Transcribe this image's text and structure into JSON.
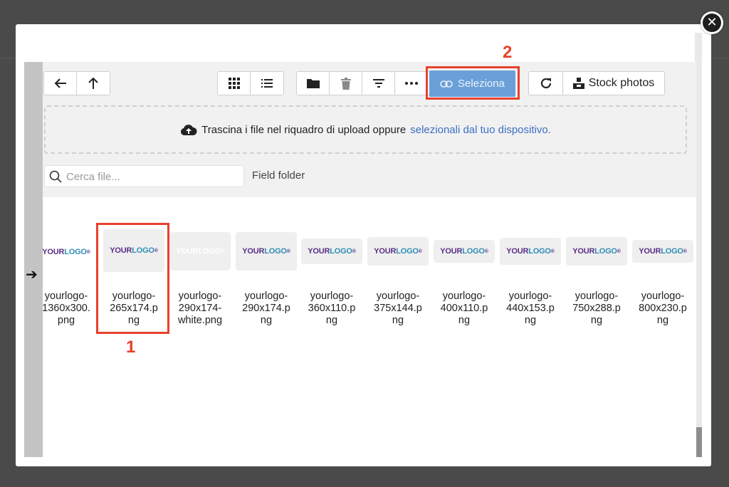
{
  "close_icon": "close-icon",
  "toolbar": {
    "back_icon": "arrow-left-icon",
    "up_icon": "arrow-up-icon",
    "grid_icon": "grid-view-icon",
    "list_icon": "list-view-icon",
    "folder_icon": "folder-icon",
    "trash_icon": "trash-icon",
    "filter_icon": "filter-icon",
    "more_icon": "more-icon",
    "select_label": "Seleziona",
    "refresh_icon": "refresh-icon",
    "stock_label": "Stock photos"
  },
  "dropzone": {
    "text": "Trascina i file nel riquadro di upload oppure",
    "link": "selezionali dal tuo dispositivo."
  },
  "search": {
    "placeholder": "Cerca file..."
  },
  "folder_label": "Field folder",
  "annotations": {
    "one": "1",
    "two": "2"
  },
  "files": [
    {
      "name": "yourlogo-1360x300.png",
      "lines": [
        "yourlogo-",
        "1360x300.",
        "png"
      ]
    },
    {
      "name": "yourlogo-265x174.png",
      "lines": [
        "yourlogo-",
        "265x174.p",
        "ng"
      ]
    },
    {
      "name": "yourlogo-290x174-white.png",
      "lines": [
        "yourlogo-",
        "290x174-",
        "white.png"
      ]
    },
    {
      "name": "yourlogo-290x174.png",
      "lines": [
        "yourlogo-",
        "290x174.p",
        "ng"
      ]
    },
    {
      "name": "yourlogo-360x110.png",
      "lines": [
        "yourlogo-",
        "360x110.p",
        "ng"
      ]
    },
    {
      "name": "yourlogo-375x144.png",
      "lines": [
        "yourlogo-",
        "375x144.p",
        "ng"
      ]
    },
    {
      "name": "yourlogo-400x110.png",
      "lines": [
        "yourlogo-",
        "400x110.p",
        "ng"
      ]
    },
    {
      "name": "yourlogo-440x153.png",
      "lines": [
        "yourlogo-",
        "440x153.p",
        "ng"
      ]
    },
    {
      "name": "yourlogo-750x288.png",
      "lines": [
        "yourlogo-",
        "750x288.p",
        "ng"
      ]
    },
    {
      "name": "yourlogo-800x230.png",
      "lines": [
        "yourlogo-",
        "800x230.p",
        "ng"
      ]
    }
  ],
  "logo": {
    "part1": "YOUR",
    "part2": "LOGO",
    "mark": "®"
  },
  "colors": {
    "select_button": "#6b9fd8",
    "annotation": "#e8412c",
    "link": "#3d6fc4"
  }
}
